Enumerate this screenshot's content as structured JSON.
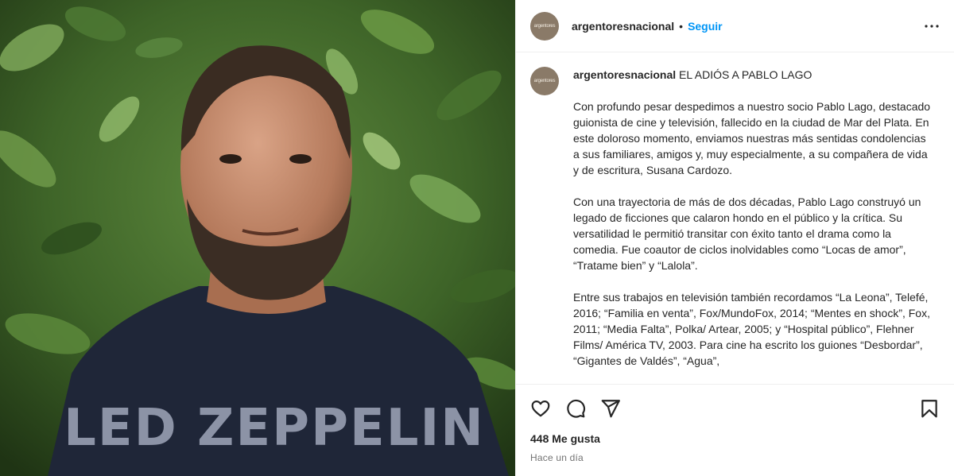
{
  "post": {
    "photo_alt": "",
    "shirt_print": "LED ZEPPELIN"
  },
  "header": {
    "avatar_text": "argentores",
    "username": "argentoresnacional",
    "separator": "•",
    "follow_label": "Seguir",
    "more_icon": "more-horizontal-icon"
  },
  "caption": {
    "username": "argentoresnacional",
    "title": "EL ADIÓS A PABLO LAGO",
    "paragraphs": [
      "Con profundo pesar despedimos a nuestro socio Pablo Lago, destacado guionista de cine y televisión, fallecido en la ciudad de Mar del Plata. En este doloroso momento, enviamos nuestras más sentidas condolencias a sus familiares, amigos y, muy especialmente, a su compañera de vida y de escritura, Susana Cardozo.",
      "Con una trayectoria de más de dos décadas, Pablo Lago construyó un legado de ficciones que calaron hondo en el público y la crítica. Su versatilidad le permitió transitar con éxito tanto el drama como la comedia. Fue coautor de ciclos inolvidables como “Locas de amor”, “Tratame bien” y “Lalola”.",
      "Entre sus trabajos en televisión también recordamos “La Leona”, Telefé, 2016; “Familia en venta”, Fox/MundoFox, 2014; “Mentes en shock”, Fox, 2011; “Media Falta”, Polka/ Artear, 2005; y “Hospital público”, Flehner Films/ América TV, 2003. Para cine ha escrito los guiones “Desbordar”, “Gigantes de Valdés”, “Agua”,"
    ]
  },
  "actions": {
    "like_icon": "heart-icon",
    "comment_icon": "comment-icon",
    "share_icon": "share-icon",
    "save_icon": "bookmark-icon",
    "likes": "448 Me gusta",
    "time": "Hace un día"
  },
  "colors": {
    "accent": "#0095f6",
    "text": "#262626",
    "muted": "#737373",
    "border": "#efefef"
  }
}
